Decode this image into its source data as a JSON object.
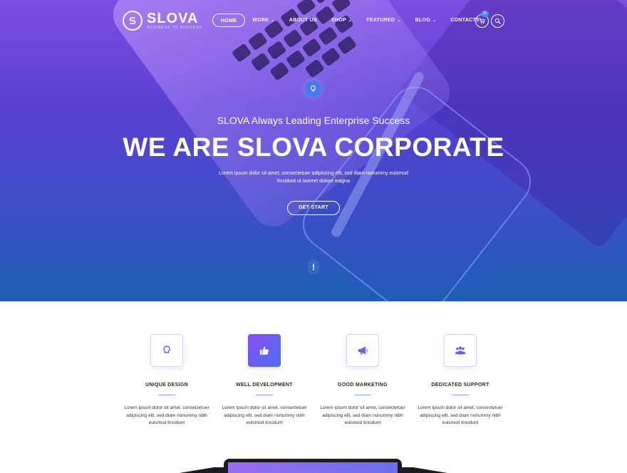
{
  "brand": {
    "name": "SLOVA",
    "tagline": "BUSINESS TO SUCCESS",
    "logo_icon": "s-logo-icon"
  },
  "nav": {
    "items": [
      {
        "label": "HOME",
        "active": true,
        "dropdown": false
      },
      {
        "label": "WORK",
        "active": false,
        "dropdown": true
      },
      {
        "label": "ABOUT US",
        "active": false,
        "dropdown": false
      },
      {
        "label": "SHOP",
        "active": false,
        "dropdown": true
      },
      {
        "label": "FEATURED",
        "active": false,
        "dropdown": true
      },
      {
        "label": "BLOG",
        "active": false,
        "dropdown": true
      },
      {
        "label": "CONTACTS",
        "active": false,
        "dropdown": false
      }
    ],
    "cart_count": "02",
    "cart_icon": "cart-icon",
    "search_icon": "search-icon"
  },
  "hero": {
    "icon": "lightbulb-icon",
    "subtitle": "SLOVA Always Leading Enterprise Success",
    "title": "WE ARE SLOVA CORPORATE",
    "description": "Lorem ipsum dolor sit amet, consectetuer adipiscing elit, sed diam nonummy euismod tincidunt ut laoreet dolore magna",
    "cta_label": "GET START",
    "scroll_glyph": "!"
  },
  "features": [
    {
      "icon": "lightbulb-icon",
      "title": "UNIQUE DESIGN",
      "description": "Lorem ipsum dolor sit amet, consectetuer adipiscing elit, sed diam nonummy nibh euismod tincidunt"
    },
    {
      "icon": "thumbs-up-icon",
      "title": "WELL DEVELOPMENT",
      "description": "Lorem ipsum dolor sit amet, consectetuer adipiscing elit, sed diam nonummy nibh euismod tincidunt"
    },
    {
      "icon": "megaphone-icon",
      "title": "GOOD MARKETING",
      "description": "Lorem ipsum dolor sit amet, consectetuer adipiscing elit, sed diam nonummy nibh euismod tincidunt"
    },
    {
      "icon": "team-icon",
      "title": "DEDICATED SUPPORT",
      "description": "Lorem ipsum dolor sit amet, consectetuer adipiscing elit, sed diam nonummy nibh euismod tincidunt"
    }
  ],
  "colors": {
    "hero_top": "#7a4fe0",
    "hero_bottom": "#1c5fb5",
    "accent": "#4a6cf2",
    "accent_purple": "#8a4ff0",
    "text_dark": "#2a2a3a"
  }
}
